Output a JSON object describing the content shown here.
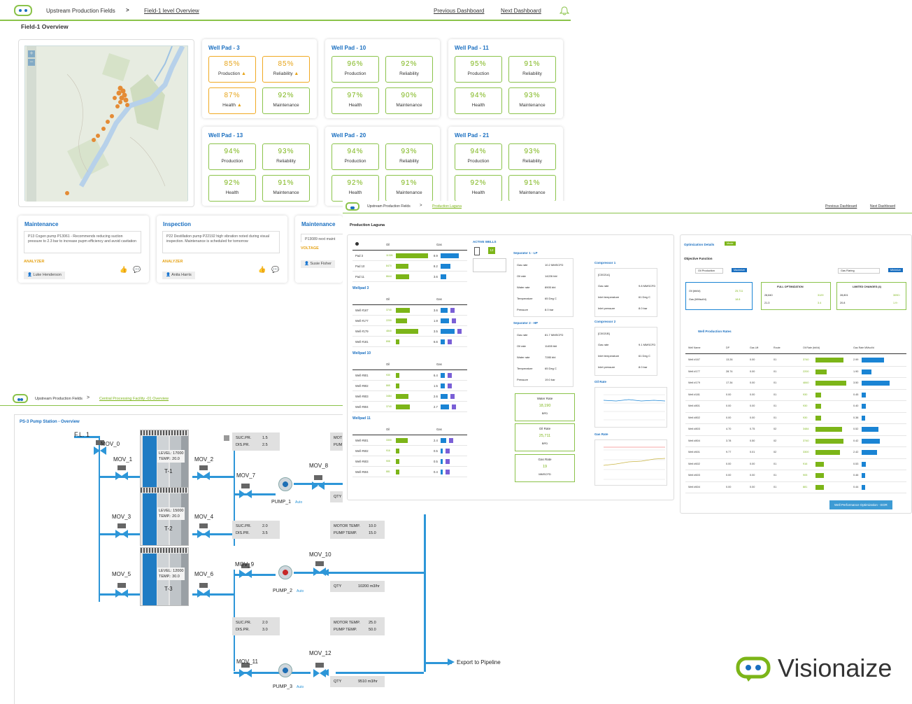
{
  "panel1": {
    "app": "Upstream Production Fields",
    "crumb_link": "Field-1 level Overview",
    "prev": "Previous Dashboard",
    "next": "Next Dashboard",
    "title": "Field-1 Overview",
    "pads": [
      {
        "name": "Well Pad - 3",
        "tiles": [
          {
            "v": "85%",
            "l": "Production",
            "w": true
          },
          {
            "v": "85%",
            "l": "Reliability",
            "w": true
          },
          {
            "v": "87%",
            "l": "Health",
            "w": true
          },
          {
            "v": "92%",
            "l": "Maintenance",
            "w": false
          }
        ]
      },
      {
        "name": "Well Pad - 10",
        "tiles": [
          {
            "v": "96%",
            "l": "Production"
          },
          {
            "v": "92%",
            "l": "Reliability"
          },
          {
            "v": "97%",
            "l": "Health"
          },
          {
            "v": "90%",
            "l": "Maintenance"
          }
        ]
      },
      {
        "name": "Well Pad - 11",
        "tiles": [
          {
            "v": "95%",
            "l": "Production"
          },
          {
            "v": "91%",
            "l": "Reliability"
          },
          {
            "v": "94%",
            "l": "Health"
          },
          {
            "v": "93%",
            "l": "Maintenance"
          }
        ]
      },
      {
        "name": "Well Pad - 13",
        "tiles": [
          {
            "v": "94%",
            "l": "Production"
          },
          {
            "v": "93%",
            "l": "Reliability"
          },
          {
            "v": "92%",
            "l": "Health"
          },
          {
            "v": "91%",
            "l": "Maintenance"
          }
        ]
      },
      {
        "name": "Well Pad - 20",
        "tiles": [
          {
            "v": "94%",
            "l": "Production"
          },
          {
            "v": "93%",
            "l": "Reliability"
          },
          {
            "v": "92%",
            "l": "Health"
          },
          {
            "v": "91%",
            "l": "Maintenance"
          }
        ]
      },
      {
        "name": "Well Pad - 21",
        "tiles": [
          {
            "v": "94%",
            "l": "Production"
          },
          {
            "v": "93%",
            "l": "Reliability"
          },
          {
            "v": "92%",
            "l": "Health"
          },
          {
            "v": "91%",
            "l": "Maintenance"
          }
        ]
      }
    ],
    "bottom": [
      {
        "title": "Maintenance",
        "msg": "P13 Cogen pump P13061 - Recommends reducing suction pressure to 2.3 bar to increase pupm efficiency and avoid cavitation",
        "sub": "ANALYZER",
        "person": "Luke Henderson"
      },
      {
        "title": "Inspection",
        "msg": "P22 Destillation pump P22192 high vibration noted during visual inspection. Maintenance is scheduled for tomorrow",
        "sub": "ANALYZER",
        "person": "Anita Harris"
      },
      {
        "title": "Maintenance",
        "msg": "P13089 next maint",
        "sub": "VOLTAGE",
        "person": "Susie Fisher"
      }
    ]
  },
  "panel2": {
    "app": "Upstream Production Fields",
    "crumb_link": "Production Laguna",
    "prev": "Previous Dashboard",
    "next": "Next Dashboard",
    "title": "Production Laguna",
    "col_oil": "Oil",
    "col_gas": "Gas",
    "pads": [
      {
        "name": "",
        "rows": [
          {
            "n": "Pad 3",
            "o": "11326",
            "g": "8.9",
            "ow": 46,
            "gw": 26
          },
          {
            "n": "Pad 10",
            "o": "8470",
            "g": "8.2",
            "ow": 18,
            "gw": 14
          },
          {
            "n": "Pad 11",
            "o": "8644",
            "g": "3.6",
            "ow": 19,
            "gw": 8
          }
        ]
      },
      {
        "name": "Wellpad 3",
        "rows": [
          {
            "n": "Well #167",
            "o": "3740",
            "g": "3.6",
            "ow": 20,
            "gw": 10
          },
          {
            "n": "Well #177",
            "o": "2200",
            "g": "1.9",
            "ow": 16,
            "gw": 12
          },
          {
            "n": "Well #179",
            "o": "4840",
            "g": "3.5",
            "ow": 32,
            "gw": 20
          },
          {
            "n": "Well #181",
            "o": "898",
            "g": "6.6",
            "ow": 5,
            "gw": 6
          }
        ]
      },
      {
        "name": "Wellpad 10",
        "rows": [
          {
            "n": "Well #801",
            "o": "930",
            "g": "6.4",
            "ow": 5,
            "gw": 6
          },
          {
            "n": "Well #802",
            "o": "865",
            "g": "1.5",
            "ow": 5,
            "gw": 6
          },
          {
            "n": "Well #803",
            "o": "3484",
            "g": "2.6",
            "ow": 18,
            "gw": 10
          },
          {
            "n": "Well #804",
            "o": "3740",
            "g": "2.7",
            "ow": 20,
            "gw": 12
          }
        ]
      },
      {
        "name": "Wellpad 11",
        "rows": [
          {
            "n": "Well #601",
            "o": "3300",
            "g": "2.4",
            "ow": 17,
            "gw": 8
          },
          {
            "n": "Well #602",
            "o": "916",
            "g": "0.5",
            "ow": 5,
            "gw": 3
          },
          {
            "n": "Well #603",
            "o": "905",
            "g": "0.5",
            "ow": 5,
            "gw": 3
          },
          {
            "n": "Well #604",
            "o": "881",
            "g": "0.4",
            "ow": 5,
            "gw": 3
          }
        ]
      }
    ],
    "active_wells": "ACTIVE WELLS",
    "active_count": "12",
    "sep1": {
      "title": "Separator 1 - LP",
      "rows": [
        [
          "Gas rate",
          "10.2 MMSCFD"
        ],
        [
          "Oil rate",
          "14226 bbl"
        ],
        [
          "Water rate",
          "8905 bbl"
        ],
        [
          "Temperature",
          "65 Deg C"
        ],
        [
          "Pressure",
          "8.0 bar"
        ]
      ]
    },
    "sep2": {
      "title": "Separator 2 - HP",
      "rows": [
        [
          "Gas rate",
          "81.7 MMSCFD"
        ],
        [
          "Oil rate",
          "11455 bbl"
        ],
        [
          "Water rate",
          "7285 bbl"
        ],
        [
          "Temperature",
          "65 Deg C"
        ],
        [
          "Pressure",
          "19.0 bar"
        ]
      ]
    },
    "comp1": {
      "title": "Compressor 1",
      "tag": "[C0021A]",
      "rows": [
        [
          "Gas rate",
          "9.8 MMSCFD"
        ],
        [
          "Inlet temperature",
          "61 Deg C"
        ],
        [
          "Inlet pressure",
          "8.0 bar"
        ]
      ]
    },
    "comp2": {
      "title": "Compressor 2",
      "tag": "[C0021B]",
      "rows": [
        [
          "Gas rate",
          "9.1 MMSCFD"
        ],
        [
          "Inlet temperature",
          "61 Deg C"
        ],
        [
          "Inlet pressure",
          "8.0 bar"
        ]
      ]
    },
    "water": {
      "label": "Water Rate",
      "value": "18,190",
      "unit": "BPD"
    },
    "oil": {
      "label": "Oil Rate",
      "value": "25,711",
      "unit": "BPD"
    },
    "gas": {
      "label": "Gas Rate",
      "value": "19",
      "unit": "MMSCFD"
    },
    "oil_chart_title": "Oil Rate",
    "gas_chart_title": "Gas Rate",
    "opt": {
      "title": "Optimization Details",
      "mode": "Mode",
      "obj": "Objective Function",
      "sel1": "Oil Production",
      "btn1": "Maximize",
      "sel2": "Gas Flaring",
      "btn2": "Minimize",
      "box1": {
        "r1": [
          "Oil (bbl/d)",
          "25,711"
        ],
        "r2": [
          "Gas (MMscf/d)",
          "18.8"
        ]
      },
      "box2": {
        "title": "FULL OPTIMIZATION",
        "r1": [
          "28,840",
          "3129"
        ],
        "r2": [
          "21.3",
          "3.4"
        ]
      },
      "box3": {
        "title": "LIMITED CHANGES (4)",
        "r1": [
          "28,801",
          "3090↑"
        ],
        "r2": [
          "20.8",
          "1.9↑"
        ]
      },
      "rates_title": "Well Production Rates",
      "cols": [
        "Well Name",
        "DP",
        "Gas Lift",
        "Route",
        "Oil Rate (bbl/d)",
        "Gas Rate MMscf/d"
      ],
      "rows": [
        [
          "Well #167",
          "13.26",
          "0.00",
          "01",
          "3740",
          "2.99",
          40,
          32
        ],
        [
          "Well #177",
          "28.74",
          "0.00",
          "01",
          "2200",
          "1.90",
          16,
          14
        ],
        [
          "Well #179",
          "17.34",
          "0.00",
          "01",
          "4840",
          "3.50",
          44,
          40
        ],
        [
          "Well #181",
          "0.00",
          "0.00",
          "01",
          "930",
          "0.45",
          8,
          6
        ],
        [
          "Well #801",
          "0.00",
          "0.00",
          "01",
          "930",
          "0.40",
          8,
          6
        ],
        [
          "Well #802",
          "0.00",
          "0.00",
          "01",
          "930",
          "0.38",
          8,
          5
        ],
        [
          "Well #803",
          "4.70",
          "0.75",
          "02",
          "3484",
          "0.52",
          38,
          24
        ],
        [
          "Well #804",
          "3.78",
          "0.50",
          "02",
          "3740",
          "0.42",
          40,
          26
        ],
        [
          "Well #601",
          "9.77",
          "0.01",
          "02",
          "3300",
          "2.42",
          35,
          22
        ],
        [
          "Well #602",
          "0.00",
          "0.00",
          "01",
          "916",
          "0.53",
          12,
          6
        ],
        [
          "Well #603",
          "0.00",
          "0.00",
          "01",
          "905",
          "0.46",
          12,
          5
        ],
        [
          "Well #604",
          "0.00",
          "0.00",
          "01",
          "881",
          "0.44",
          12,
          5
        ]
      ],
      "btn": "Well Performance Optimization - EOR"
    }
  },
  "panel3": {
    "app": "Upstream Production Fields",
    "crumb_link": "Central Processing Facility -01 Overview",
    "title": "PS-3 Pump Station - Overview",
    "fl": "F.L. 1",
    "tanks": [
      {
        "name": "T-1",
        "level": "LEVEL: 17000",
        "temp": "TEMP.: 20.0"
      },
      {
        "name": "T-2",
        "level": "LEVEL: 15000",
        "temp": "TEMP.: 20.0"
      },
      {
        "name": "T-3",
        "level": "LEVEL: 12000",
        "temp": "TEMP.: 30.0"
      }
    ],
    "valves": [
      "MOV_0",
      "MOV_1",
      "MOV_2",
      "MOV_3",
      "MOV_4",
      "MOV_5",
      "MOV_6",
      "MOV_7",
      "MOV_8",
      "MOV_9",
      "MOV_10",
      "MOV_11",
      "MOV_12"
    ],
    "pumps": [
      {
        "name": "PUMP_1",
        "mode": "Auto"
      },
      {
        "name": "PUMP_2",
        "mode": "Auto"
      },
      {
        "name": "PUMP_3",
        "mode": "Auto"
      }
    ],
    "g1": {
      "a": "SUC.PR.",
      "av": "1.5",
      "b": "DIS.PR.",
      "bv": "2.5"
    },
    "g2": {
      "a": "SUC.PR.",
      "av": "2.0",
      "b": "DIS.PR.",
      "bv": "3.5"
    },
    "g3": {
      "a": "SUC.PR.",
      "av": "2.0",
      "b": "DIS.PR.",
      "bv": "3.0"
    },
    "m1": {
      "a": "MOTOR TEMP.",
      "av": "10.0",
      "b": "PUMP TEMP.",
      "bv": "15.0"
    },
    "m2": {
      "a": "MOTOR TEMP.",
      "av": "25.0",
      "b": "PUMP TEMP.",
      "bv": "50.0"
    },
    "m0": {
      "a": "MOT",
      "b": "PUM"
    },
    "qty1": "QTY",
    "qty2": {
      "a": "QTY",
      "v": "10200 m3/hr"
    },
    "qty3": {
      "a": "QTY",
      "v": "9510 m3/hr"
    },
    "export": "Export to Pipeline"
  },
  "brand": "Visionaize"
}
